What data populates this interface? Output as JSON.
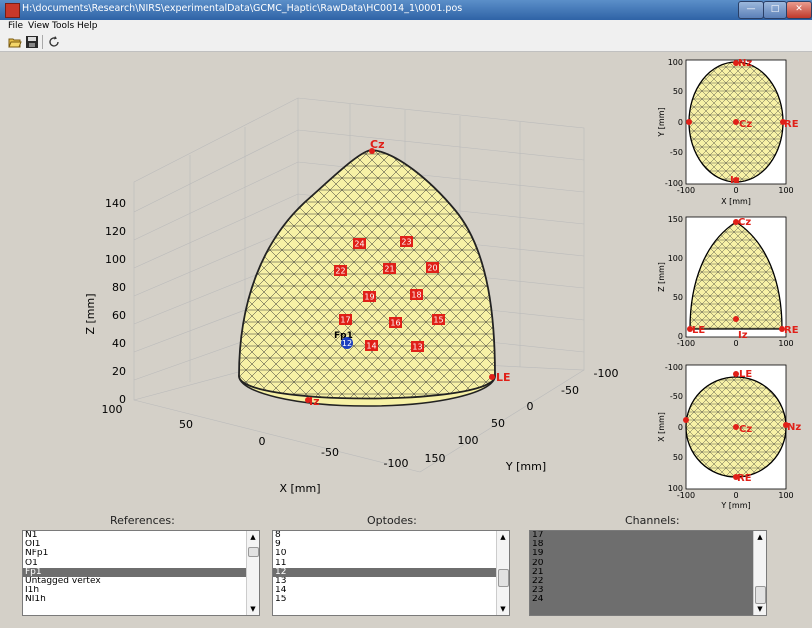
{
  "window": {
    "title": "H:\\documents\\Research\\NIRS\\experimentalData\\GCMC_Haptic\\RawData\\HC0014_1\\0001.pos"
  },
  "menu": {
    "items": [
      "File",
      "View",
      "Tools",
      "Help"
    ]
  },
  "toolbar": {
    "icons": [
      "open-folder-icon",
      "save-icon",
      "rotate-icon"
    ]
  },
  "main_view": {
    "xlabel": "X [mm]",
    "ylabel": "Y [mm]",
    "zlabel": "Z [mm]",
    "z_ticks": [
      "0",
      "20",
      "40",
      "60",
      "80",
      "100",
      "120",
      "140"
    ],
    "x_ticks": [
      "100",
      "50",
      "0",
      "-50",
      "-100"
    ],
    "y_ticks": [
      "-100",
      "-50",
      "0",
      "50",
      "100",
      "150"
    ],
    "landmarks": {
      "cz": "Cz",
      "le": "LE",
      "iz": "Iz",
      "fp1": "Fp1"
    },
    "optodes": [
      "24",
      "23",
      "22",
      "21",
      "20",
      "19",
      "18",
      "17",
      "16",
      "15",
      "14",
      "13",
      "12"
    ]
  },
  "side_views": {
    "top": {
      "ylabel": "Y [mm]",
      "xlabel": "X [mm]",
      "left_ticks": [
        "100",
        "50",
        "0",
        "-50",
        "-100"
      ],
      "bottom_ticks": [
        "-100",
        "0",
        "100"
      ],
      "labels": [
        "Nz",
        "Cz",
        "RE",
        "Iz"
      ]
    },
    "front": {
      "ylabel": "Z [mm]",
      "xlabel": "",
      "left_ticks": [
        "150",
        "100",
        "50",
        "0"
      ],
      "bottom_ticks": [
        "-100",
        "0",
        "100"
      ],
      "labels": [
        "Cz",
        "LE",
        "Iz",
        "RE"
      ]
    },
    "side": {
      "ylabel": "X [mm]",
      "xlabel": "Y [mm]",
      "left_ticks": [
        "-100",
        "-50",
        "0",
        "50",
        "100"
      ],
      "bottom_ticks": [
        "-100",
        "0",
        "100"
      ],
      "labels": [
        "LE",
        "Nz",
        "Cz",
        "RE"
      ]
    }
  },
  "panels": {
    "references": {
      "title": "References:",
      "items": [
        "N1",
        "OI1",
        "NFp1",
        "O1",
        "Fp1",
        "Untagged vertex",
        "I1h",
        "NI1h"
      ],
      "selected": "Fp1"
    },
    "optodes": {
      "title": "Optodes:",
      "items": [
        "8",
        "9",
        "10",
        "11",
        "12",
        "13",
        "14",
        "15"
      ],
      "selected": "12"
    },
    "channels": {
      "title": "Channels:",
      "items": [
        "17",
        "18",
        "19",
        "20",
        "21",
        "22",
        "23",
        "24"
      ]
    }
  },
  "colors": {
    "head_fill": "#f7f1a6",
    "marker": "#e02018",
    "selected_optode": "#1c3fc0",
    "title_bar": "#2f63a6"
  }
}
